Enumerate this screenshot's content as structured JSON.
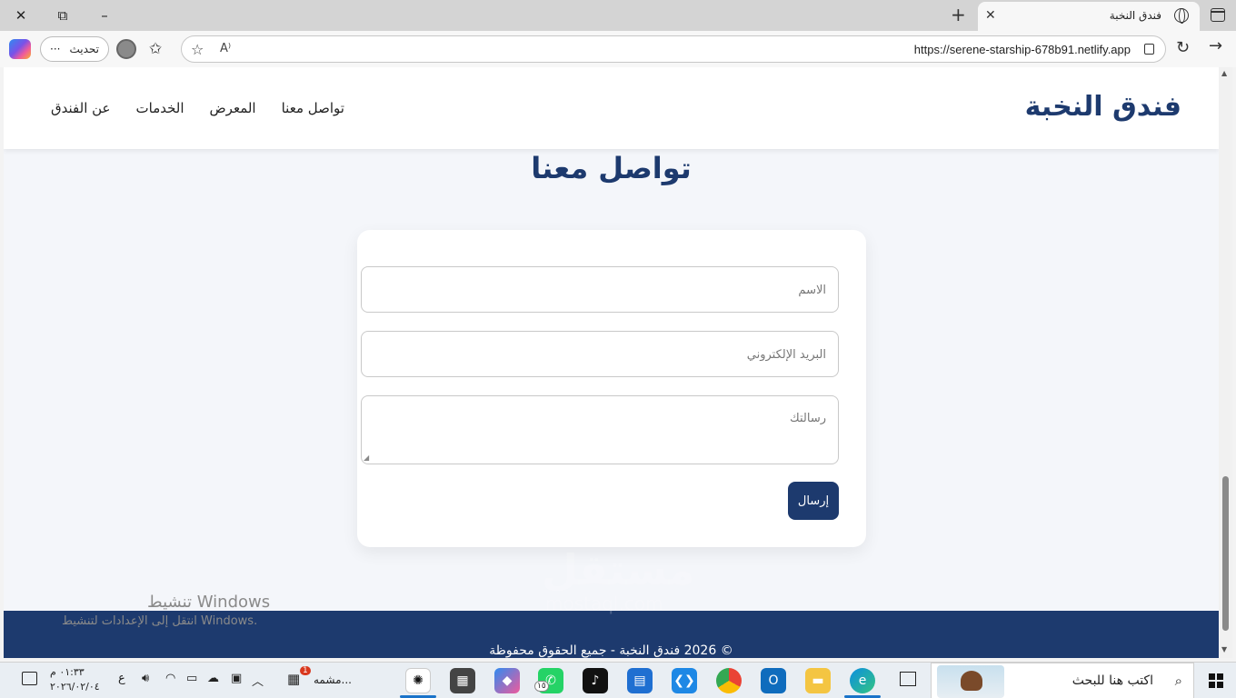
{
  "browser": {
    "tab_title": "فندق النخبة",
    "url": "https://serene-starship-678b91.netlify.app",
    "update_label": "تحديث",
    "more_label": "···"
  },
  "site": {
    "logo": "فندق النخبة",
    "nav": [
      "عن الفندق",
      "الخدمات",
      "المعرض",
      "تواصل معنا"
    ],
    "section_title": "تواصل معنا",
    "form": {
      "name_placeholder": "الاسم",
      "email_placeholder": "البريد الإلكتروني",
      "message_placeholder": "رسالتك",
      "submit_label": "إرسال"
    },
    "footer": "© 2026 فندق النخبة - جميع الحقوق محفوظة"
  },
  "overlay": {
    "activate_title": "تنشيط Windows",
    "activate_sub": "انتقل إلى الإعدادات لتنشيط Windows.",
    "watermark": "مستقل",
    "watermark_site": "mostaql.com"
  },
  "taskbar": {
    "search_placeholder": "اكتب هنا للبحث",
    "time": "٠١:٣٣ م",
    "date": "٢٠٢٦/٠٢/٠٤",
    "lang": "ع",
    "running_label": "مشمه...",
    "badge_count": "1",
    "whatsapp_badge": "١٥"
  },
  "colors": {
    "brand": "#1d3a6e",
    "page_bg": "#f4f6fa",
    "footer_bg": "#1d3a6e"
  }
}
